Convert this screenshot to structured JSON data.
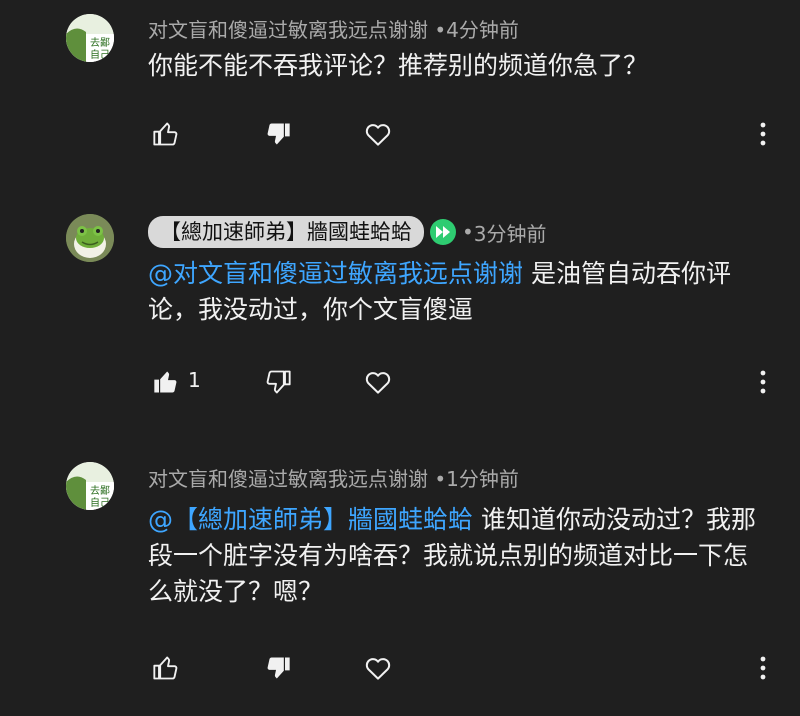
{
  "comments": [
    {
      "author": "对文盲和傻逼过敏离我远点谢谢",
      "separator": "•",
      "time": "4分钟前",
      "text": "你能不能不吞我评论？推荐别的频道你急了？",
      "likes": "",
      "liked": false,
      "disliked": true,
      "avatar_text_top": "去鄙",
      "avatar_text_bottom": "自己"
    },
    {
      "author": "【總加速師弟】牆國蛙蛤蛤",
      "separator": "•",
      "time": "3分钟前",
      "mention": "@对文盲和傻逼过敏离我远点谢谢",
      "text": " 是油管自动吞你评论，我没动过，你个文盲傻逼",
      "likes": "1",
      "liked": true,
      "disliked": false
    },
    {
      "author": "对文盲和傻逼过敏离我远点谢谢",
      "separator": "•",
      "time": "1分钟前",
      "mention": "@【總加速師弟】牆國蛙蛤蛤",
      "text": " 谁知道你动没动过？我那段一个脏字没有为啥吞？我就说点别的频道对比一下怎么就没了？嗯？",
      "likes": "",
      "liked": false,
      "disliked": true,
      "avatar_text_top": "去鄙",
      "avatar_text_bottom": "自己"
    }
  ],
  "icons": {
    "like": "thumb-up-icon",
    "dislike": "thumb-down-icon",
    "heart": "heart-icon",
    "more": "more-vert-icon",
    "badge": "fast-forward-icon"
  },
  "colors": {
    "background": "#1f1f1f",
    "mention": "#3ea6ff",
    "meta": "#aaaaaa",
    "badge": "#2ecc71"
  }
}
